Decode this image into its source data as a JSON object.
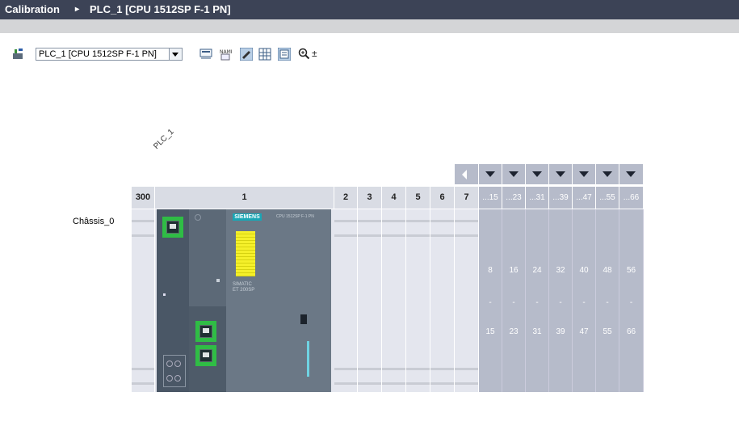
{
  "title_bar": {
    "project": "Calibration",
    "separator": "▸",
    "device": "PLC_1 [CPU 1512SP F-1 PN]"
  },
  "toolbar": {
    "device_select_value": "PLC_1 [CPU 1512SP F-1 PN]",
    "icons": [
      "device-config-icon",
      "network-icon",
      "name-icon",
      "device-view-icon",
      "grid-icon",
      "module-list-icon",
      "zoom-in-icon",
      "zoom-dropdown-icon"
    ],
    "zoom_suffix": "±"
  },
  "device_view": {
    "plc_name": "PLC_1",
    "rack_name": "Châssis_0",
    "slot_headers": [
      "300",
      "1",
      "2",
      "3",
      "4",
      "5",
      "6",
      "7"
    ],
    "group_headers": [
      "...15",
      "...23",
      "...31",
      "...39",
      "...47",
      "...55",
      "...66"
    ],
    "group_start": [
      "8",
      "16",
      "24",
      "32",
      "40",
      "48",
      "56"
    ],
    "group_sep": "-",
    "group_end": [
      "15",
      "23",
      "31",
      "39",
      "47",
      "55",
      "66"
    ],
    "module_brand": "SIEMENS",
    "module_label_1": "SIMATIC",
    "module_label_2": "ET 200SP",
    "module_cpu_text": "CPU 1512SP F-1 PN"
  },
  "colors": {
    "title_bg": "#3c4356",
    "port_green": "#2fbd45",
    "label_yellow": "#f5f02a",
    "module_dark": "#4a5766",
    "module_mid": "#5c6977",
    "slot_light": "#e4e6ee",
    "group_bg": "#b6bbca",
    "cyan_led": "#6fd3e3"
  }
}
